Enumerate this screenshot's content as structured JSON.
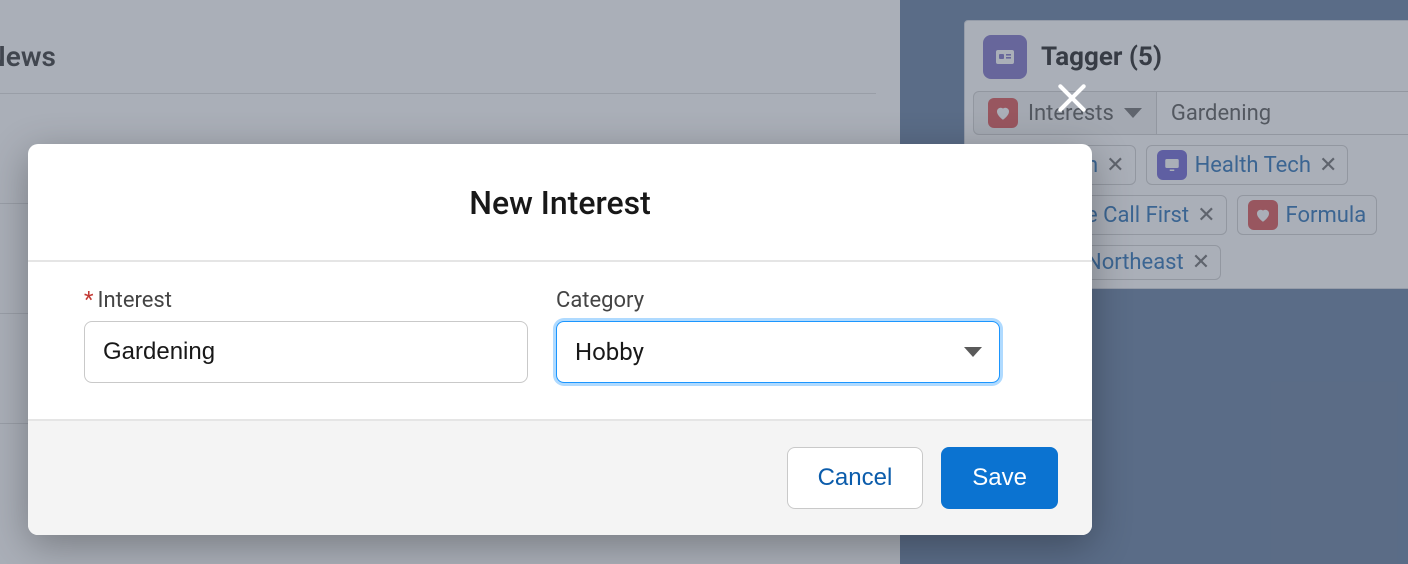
{
  "background": {
    "heading": "News"
  },
  "panel": {
    "title": "Tagger (5)",
    "tabs": {
      "dropdown_label": "Interests",
      "value": "Gardening"
    },
    "tags": {
      "row1_partial": "h",
      "row1_b": "Health Tech",
      "row2_partial": "e Call First",
      "row2_b": "Formula",
      "row3_partial": "Northeast"
    }
  },
  "modal": {
    "title": "New Interest",
    "interest_label": "Interest",
    "interest_value": "Gardening",
    "category_label": "Category",
    "category_value": "Hobby",
    "cancel_label": "Cancel",
    "save_label": "Save"
  }
}
